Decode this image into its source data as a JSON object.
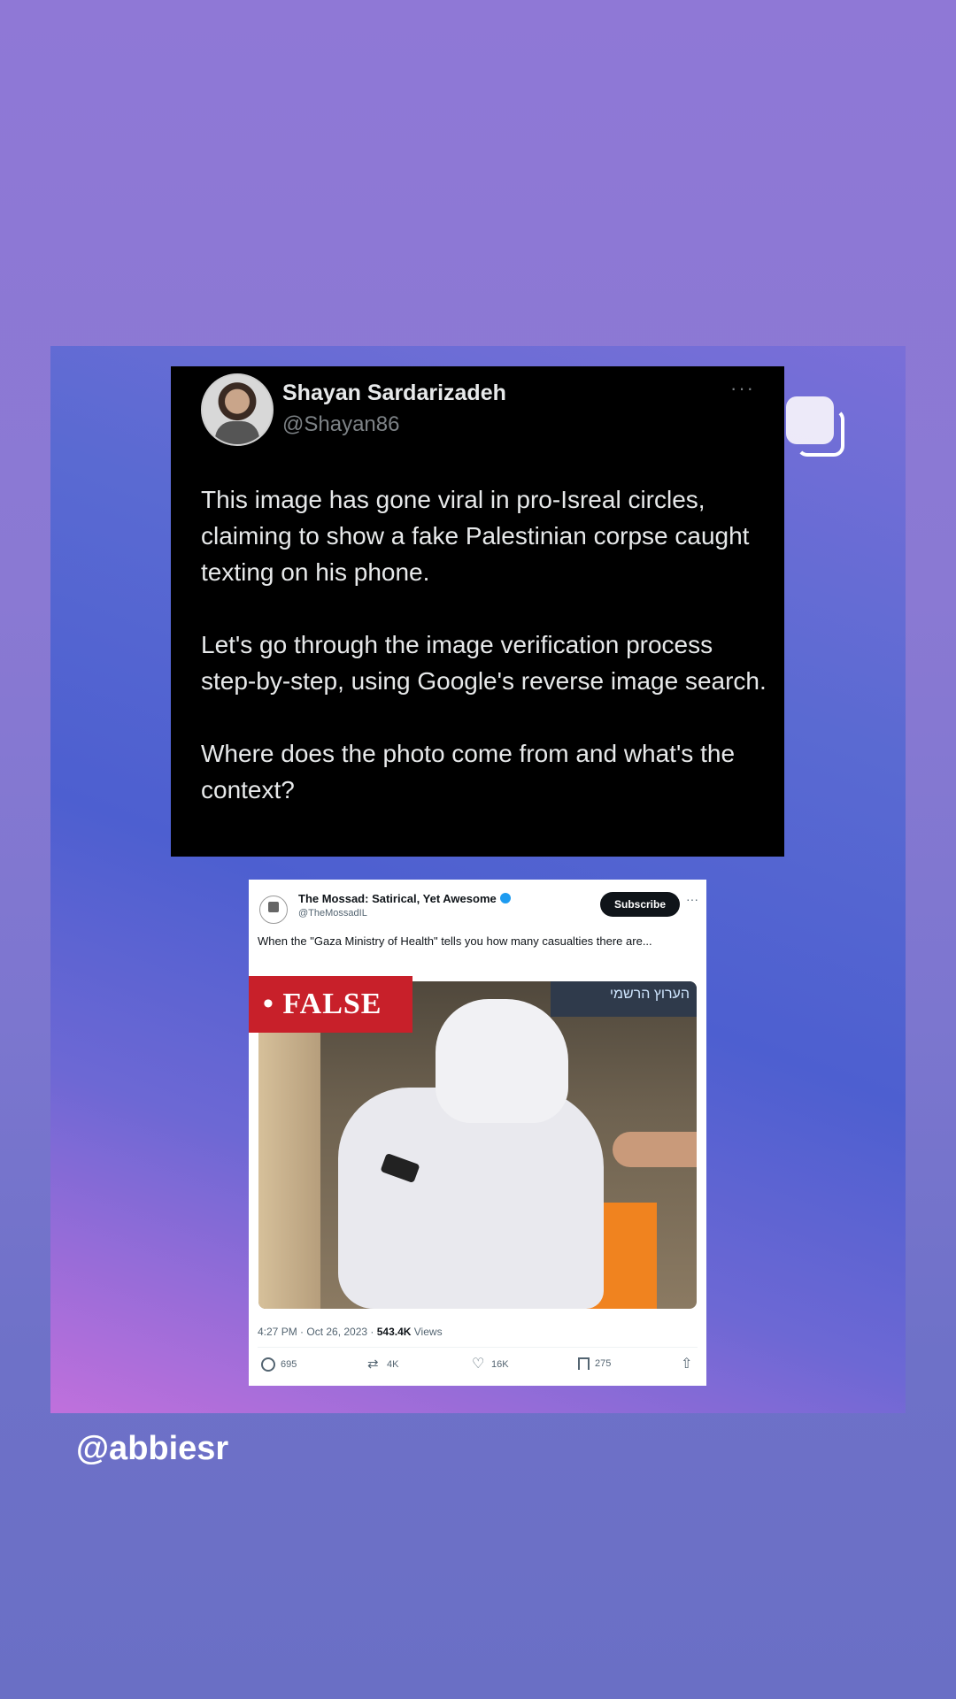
{
  "main_tweet": {
    "author_name": "Shayan Sardarizadeh",
    "author_handle": "@Shayan86",
    "more": "···",
    "paragraphs": [
      "This image has gone viral in pro-Isreal circles, claiming to show a fake Palestinian corpse caught texting on his phone.",
      "Let's go through the image verification process step-by-step, using Google's reverse image search.",
      "Where does the photo come from and what's the context?"
    ]
  },
  "quoted_tweet": {
    "author_name": "The Mossad: Satirical, Yet Awesome",
    "author_handle": "@TheMossadIL",
    "subscribe_label": "Subscribe",
    "more": "···",
    "text": "When the \"Gaza Ministry of Health\" tells you how many casualties there are...",
    "badge": "• FALSE",
    "media_sign_text": "הערוץ הרשמי",
    "timestamp": "4:27 PM · Oct 26, 2023 · ",
    "views_count": "543.4K",
    "views_label": " Views",
    "actions": {
      "replies": "695",
      "reposts": "4K",
      "likes": "16K",
      "bookmarks": "275"
    }
  },
  "watermark": "@abbiesr",
  "colors": {
    "background_top": "#8f78d6",
    "background_bottom": "#6a6fc5",
    "false_badge": "#c8202a",
    "verified": "#1d9bf0"
  },
  "icons": [
    "copy-icon",
    "reply-icon",
    "repost-icon",
    "like-icon",
    "bookmark-icon",
    "share-icon",
    "verified-icon"
  ]
}
